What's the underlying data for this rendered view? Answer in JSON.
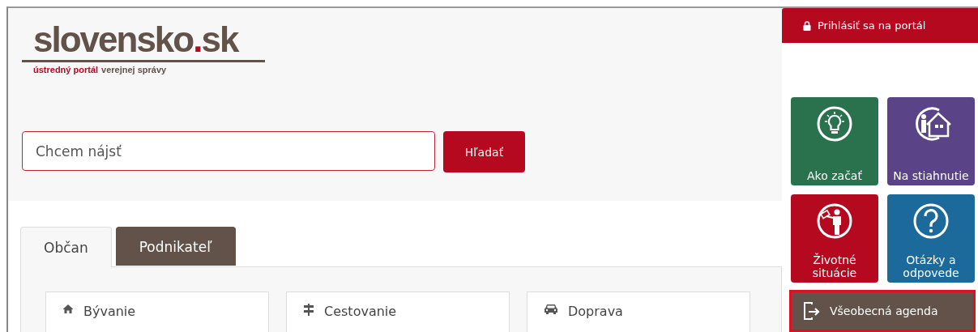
{
  "logo": {
    "name": "slovensko",
    "dot": ".",
    "tld": "sk",
    "tagline_accent": "ústredný portál",
    "tagline_rest": "verejnej správy"
  },
  "search": {
    "placeholder": "Chcem nájsť",
    "button": "Hľadať"
  },
  "tabs": [
    {
      "label": "Občan",
      "selected": true
    },
    {
      "label": "Podnikateľ",
      "selected": false
    }
  ],
  "categories": [
    {
      "label": "Bývanie"
    },
    {
      "label": "Cestovanie"
    },
    {
      "label": "Doprava"
    }
  ],
  "login": {
    "label": "Prihlásiť sa na portál"
  },
  "tiles": [
    {
      "label": "Ako začať",
      "color": "#2a714e"
    },
    {
      "label": "Na stiahnutie",
      "color": "#5b4387"
    },
    {
      "label": "Životné situácie",
      "color": "#b5091f"
    },
    {
      "label": "Otázky a odpovede",
      "color": "#1c6a9c"
    }
  ],
  "agenda": {
    "label": "Všeobecná agenda",
    "highlighted": true
  }
}
